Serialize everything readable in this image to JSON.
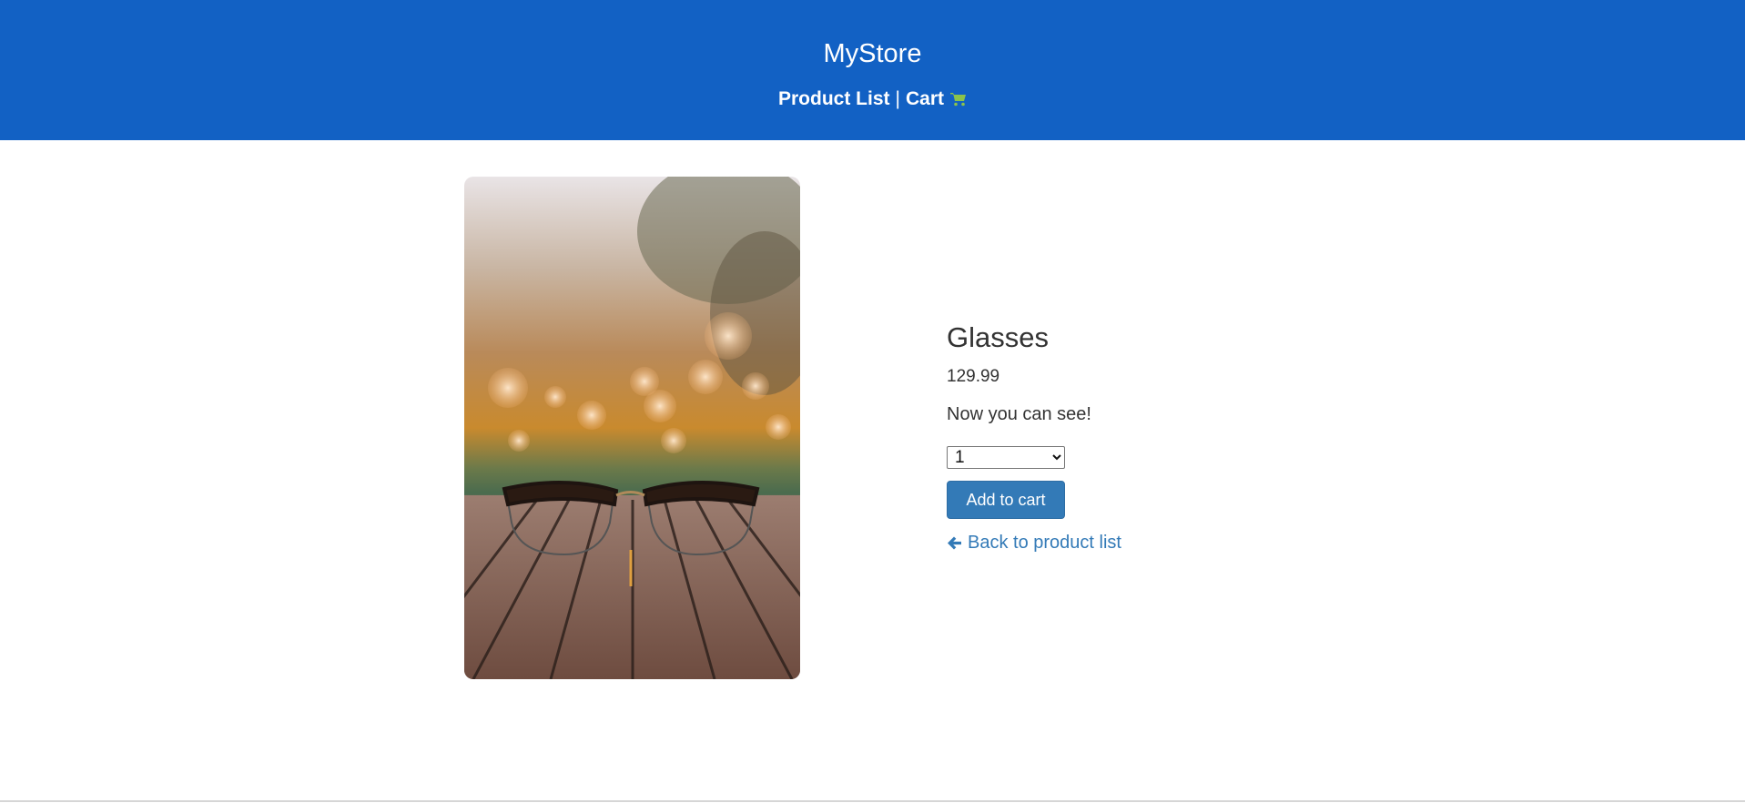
{
  "header": {
    "brand": "MyStore",
    "nav": {
      "product_list": "Product List",
      "separator": "|",
      "cart": "Cart",
      "cart_icon": "shopping-cart-icon"
    },
    "background": "#1261c4",
    "cart_icon_color": "#8bc34a"
  },
  "product": {
    "name": "Glasses",
    "price": "129.99",
    "description": "Now you can see!",
    "image_icon": "product-photo-glasses",
    "quantity": {
      "selected": "1",
      "options": [
        "1"
      ]
    },
    "add_to_cart_label": "Add to cart",
    "back_link_label": "Back to product list",
    "back_icon": "arrow-left-icon",
    "button_color": "#337ab7"
  }
}
